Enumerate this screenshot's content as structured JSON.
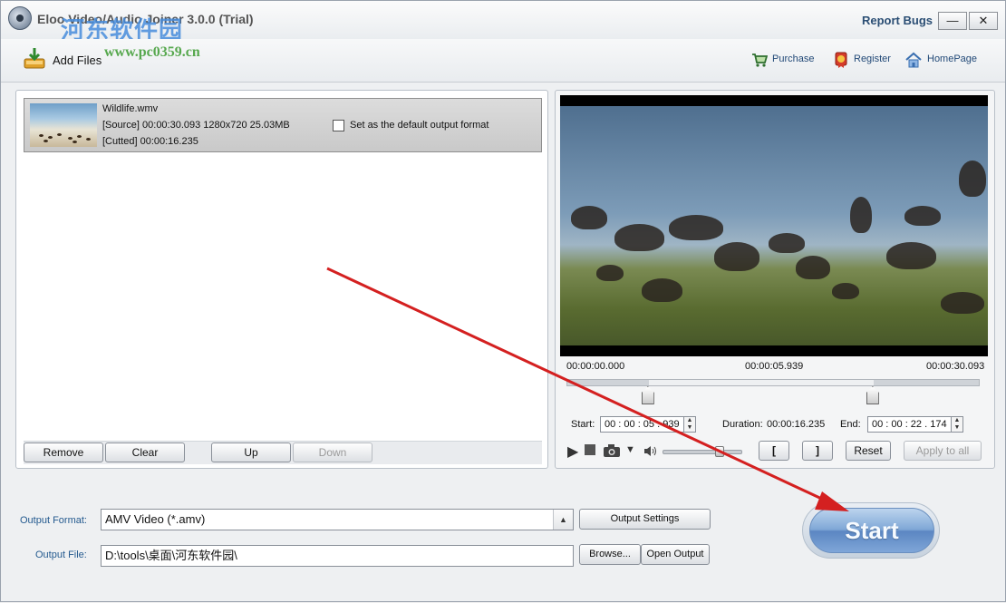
{
  "window": {
    "title": "Eloo Video/Audio Joiner 3.0.0 (Trial)",
    "report_bugs": "Report Bugs",
    "minimize": "—",
    "close": "✕"
  },
  "watermark": {
    "cn_text": "河东软件园",
    "url": "www.pc0359.cn"
  },
  "toolbar": {
    "add_files": "Add Files",
    "purchase": "Purchase",
    "register": "Register",
    "homepage": "HomePage"
  },
  "file_list": {
    "items": [
      {
        "name": "Wildlife.wmv",
        "source_line": "[Source]  00:00:30.093  1280x720  25.03MB",
        "cutted_line": "[Cutted]  00:00:16.235",
        "default_format_label": "Set as the default output format",
        "default_format_checked": false
      }
    ],
    "buttons": {
      "remove": "Remove",
      "clear": "Clear",
      "up": "Up",
      "down": "Down"
    }
  },
  "player": {
    "time_start": "00:00:00.000",
    "time_mid": "00:00:05.939",
    "time_end": "00:00:30.093",
    "selection_start_fraction": 0.197,
    "selection_end_fraction": 0.741,
    "start_label": "Start:",
    "start_value": "00 : 00 : 05 . 939",
    "duration_label": "Duration:",
    "duration_value": "00:00:16.235",
    "end_label": "End:",
    "end_value": "00 : 00 : 22 . 174",
    "volume_fraction": 0.72,
    "mark_in": "[",
    "mark_out": "]",
    "reset": "Reset",
    "apply_to_all": "Apply to all"
  },
  "output": {
    "format_label": "Output Format:",
    "format_value": "AMV Video (*.amv)",
    "settings_button": "Output Settings",
    "file_label": "Output File:",
    "file_value": "D:\\tools\\桌面\\河东软件园\\",
    "browse_button": "Browse...",
    "open_output_button": "Open Output",
    "start_button": "Start"
  },
  "icons": {
    "play": "play-icon",
    "stop": "stop-icon",
    "snapshot": "camera-icon",
    "volume": "volume-icon"
  },
  "colors": {
    "annotation_arrow": "#d42020",
    "start_button": "#6f97cf",
    "link_text": "#234a78"
  }
}
